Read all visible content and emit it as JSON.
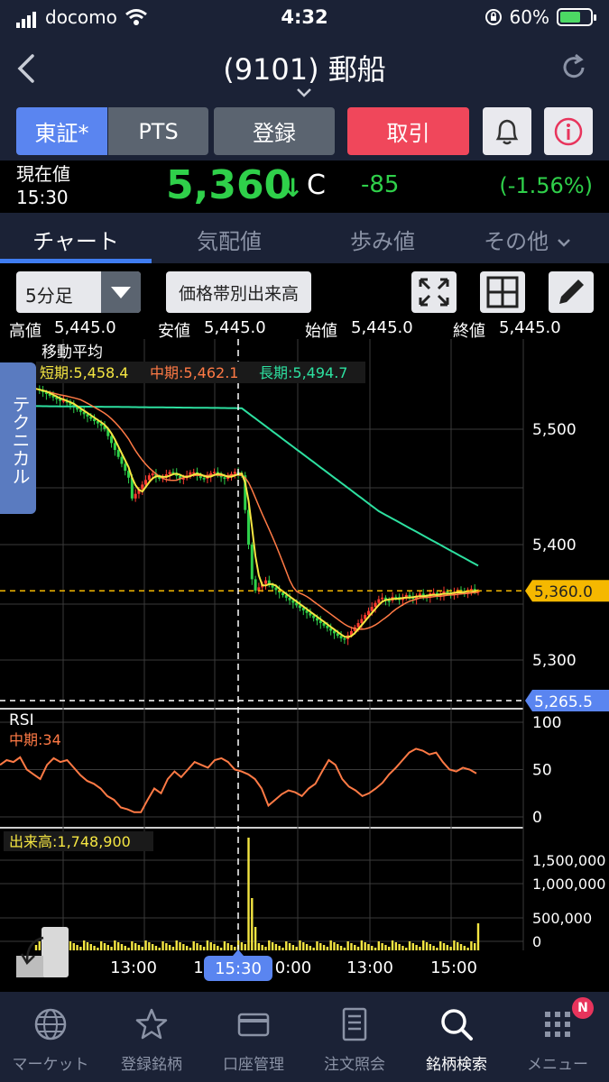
{
  "status_bar": {
    "carrier": "docomo",
    "time": "4:32",
    "battery": "60%"
  },
  "header": {
    "title": "(9101) 郵船"
  },
  "buttons": {
    "tse": "東証*",
    "pts": "PTS",
    "register": "登録",
    "trade": "取引"
  },
  "price": {
    "label": "現在値",
    "time": "15:30",
    "value": "5,360",
    "arrow": "↓",
    "flag": "C",
    "change": "-85",
    "change_pct": "(-1.56%)"
  },
  "tabs": [
    "チャート",
    "気配値",
    "歩み値",
    "その他"
  ],
  "toolbar": {
    "interval": "5分足",
    "volume_profile": "価格帯別出来高"
  },
  "ohlc": {
    "high_label": "高値",
    "high": "5,445.0",
    "low_label": "安値",
    "low": "5,445.0",
    "open_label": "始値",
    "open": "5,445.0",
    "close_label": "終値",
    "close": "5,445.0"
  },
  "technical_tab": "テクニカル",
  "colors": {
    "up": "#ff3b30",
    "down": "#2fd04a",
    "short_ma": "#f5e642",
    "mid_ma": "#ff7a45",
    "long_ma": "#2de0a0",
    "rsi": "#ff7a45",
    "volume": "#f5e642",
    "accent": "#3f7cf0"
  },
  "chart_data": {
    "type": "candlestick",
    "ma_title": "移動平均",
    "ma_labels": {
      "short": "短期:5,458.4",
      "mid": "中期:5,462.1",
      "long": "長期:5,494.7"
    },
    "price_ticks": [
      5500,
      5400,
      5300
    ],
    "price_tick_labels": [
      "5,500",
      "5,400",
      "5,300"
    ],
    "current_price_label": "5,360.0",
    "lower_line_label": "5,265.5",
    "rsi_title": "RSI",
    "rsi_label": "中期:34",
    "rsi_ticks": [
      "100",
      "50",
      "0"
    ],
    "volume_label": "出来高:1,748,900",
    "volume_ticks": [
      "1,500,000",
      "1,000,000",
      "500,000",
      "0"
    ],
    "time_labels": [
      "13:00",
      "1",
      "0:00",
      "13:00",
      "15:00"
    ],
    "crosshair_label": "15:30"
  },
  "nav": [
    {
      "label": "マーケット"
    },
    {
      "label": "登録銘柄"
    },
    {
      "label": "口座管理"
    },
    {
      "label": "注文照会"
    },
    {
      "label": "銘柄検索"
    },
    {
      "label": "メニュー"
    }
  ],
  "nav_badge": "N"
}
